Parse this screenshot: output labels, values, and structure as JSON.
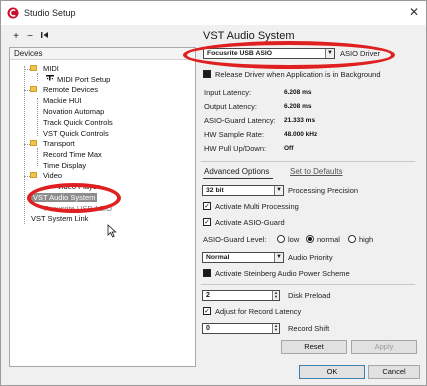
{
  "window": {
    "title": "Studio Setup",
    "close_label": "✕"
  },
  "toolbar": {
    "add_label": "+",
    "remove_label": "−",
    "reset_label": "⏮"
  },
  "devices": {
    "header": "Devices",
    "items": [
      {
        "label": "MIDI"
      },
      {
        "label": "MIDI Port Setup"
      },
      {
        "label": "Remote Devices"
      },
      {
        "label": "Mackie HUI"
      },
      {
        "label": "Novation Automap"
      },
      {
        "label": "Track Quick Controls"
      },
      {
        "label": "VST Quick Controls"
      },
      {
        "label": "Transport"
      },
      {
        "label": "Record Time Max"
      },
      {
        "label": "Time Display"
      },
      {
        "label": "Video"
      },
      {
        "label": "Video Player"
      },
      {
        "label": "VST Audio System"
      },
      {
        "label": "Focusrite USB ASIO"
      },
      {
        "label": "VST System Link"
      }
    ]
  },
  "panel": {
    "title": "VST Audio System",
    "asio_driver": {
      "value": "Focusrite USB ASIO",
      "label": "ASIO Driver"
    },
    "release_driver_label": "Release Driver when Application is in Background",
    "stats": [
      {
        "label": "Input Latency:",
        "value": "6.208 ms"
      },
      {
        "label": "Output Latency:",
        "value": "6.208 ms"
      },
      {
        "label": "ASIO-Guard Latency:",
        "value": "21.333 ms"
      },
      {
        "label": "HW Sample Rate:",
        "value": "48.000 kHz"
      },
      {
        "label": "HW Pull Up/Down:",
        "value": "Off"
      }
    ],
    "tabs": {
      "advanced": "Advanced Options",
      "defaults": "Set to Defaults"
    },
    "processing_precision": {
      "value": "32 bit",
      "label": "Processing Precision"
    },
    "multi_processing_label": "Activate Multi Processing",
    "asio_guard_label": "Activate ASIO-Guard",
    "asio_guard_level": {
      "label": "ASIO-Guard Level:",
      "options": [
        "low",
        "normal",
        "high"
      ]
    },
    "audio_priority": {
      "value": "Normal",
      "label": "Audio Priority"
    },
    "power_scheme_label": "Activate Steinberg Audio Power Scheme",
    "disk_preload": {
      "value": "2",
      "label": "Disk Preload"
    },
    "adjust_latency_label": "Adjust for Record Latency",
    "record_shift": {
      "value": "0",
      "label": "Record Shift"
    },
    "reset_button": "Reset",
    "apply_button": "Apply"
  },
  "footer": {
    "ok": "OK",
    "cancel": "Cancel"
  },
  "colors": {
    "annotation": "#e02020",
    "selection": "#8d8d8d",
    "folder": "#f3c44a"
  }
}
